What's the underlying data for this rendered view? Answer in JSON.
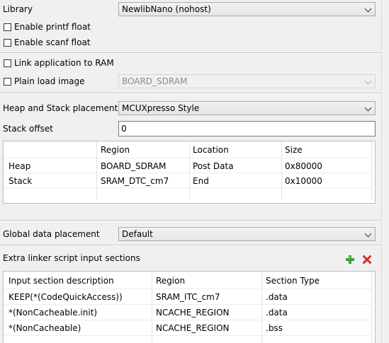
{
  "library": {
    "label": "Library",
    "value": "NewlibNano (nohost)"
  },
  "checkboxes": {
    "printf_float": "Enable printf float",
    "scanf_float": "Enable scanf float",
    "link_to_ram": "Link application to RAM",
    "plain_load": "Plain load image",
    "plain_load_region": "BOARD_SDRAM"
  },
  "heap_stack": {
    "label": "Heap and Stack placement",
    "value": "MCUXpresso Style"
  },
  "stack_offset": {
    "label": "Stack offset",
    "value": "0"
  },
  "heap_table": {
    "headers": [
      "",
      "Region",
      "Location",
      "Size"
    ],
    "rows": [
      [
        "Heap",
        "BOARD_SDRAM",
        "Post Data",
        "0x80000"
      ],
      [
        "Stack",
        "SRAM_DTC_cm7",
        "End",
        "0x10000"
      ]
    ]
  },
  "global_data": {
    "label": "Global data placement",
    "value": "Default"
  },
  "extra_linker": {
    "label": "Extra linker script input sections",
    "add_icon": "add-icon",
    "remove_icon": "remove-icon"
  },
  "sections_table": {
    "headers": [
      "Input section description",
      "Region",
      "Section Type"
    ],
    "rows": [
      [
        "KEEP(*(CodeQuickAccess))",
        "SRAM_ITC_cm7",
        ".data"
      ],
      [
        "*(NonCacheable.init)",
        "NCACHE_REGION",
        ".data"
      ],
      [
        "*(NonCacheable)",
        "NCACHE_REGION",
        ".bss"
      ]
    ]
  }
}
